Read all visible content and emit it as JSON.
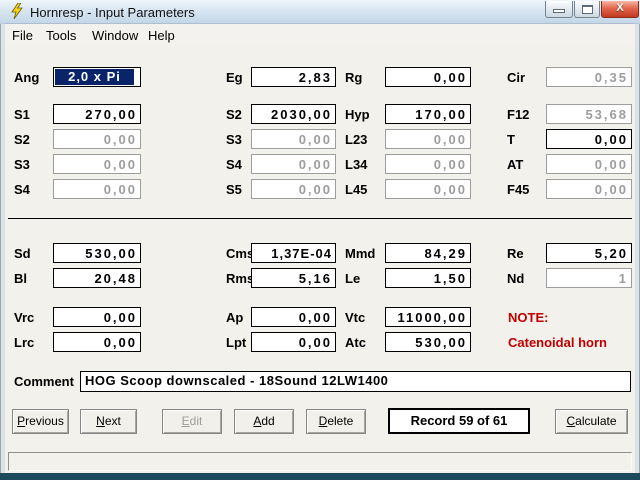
{
  "window": {
    "title": "Hornresp - Input Parameters",
    "icons": {
      "app_icon": "hornresp-lightning-bolt",
      "minimize_icon": "window-minimize",
      "maximize_icon": "window-maximize",
      "close_icon": "window-close"
    },
    "close_glyph": "X"
  },
  "menu": {
    "items": [
      "File",
      "Tools",
      "Window",
      "Help"
    ]
  },
  "fields": {
    "ang": {
      "label": "Ang",
      "value": "2,0 x Pi",
      "state": "selected"
    },
    "eg": {
      "label": "Eg",
      "value": "2,83"
    },
    "rg": {
      "label": "Rg",
      "value": "0,00"
    },
    "cir": {
      "label": "Cir",
      "value": "0,35",
      "state": "disabled"
    },
    "s1": {
      "label": "S1",
      "value": "270,00"
    },
    "s2a": {
      "label": "S2",
      "value": "2030,00"
    },
    "hyp": {
      "label": "Hyp",
      "value": "170,00"
    },
    "f12": {
      "label": "F12",
      "value": "53,68",
      "state": "disabled"
    },
    "s2b": {
      "label": "S2",
      "value": "0,00",
      "state": "disabled"
    },
    "s3a": {
      "label": "S3",
      "value": "0,00",
      "state": "disabled"
    },
    "l23": {
      "label": "L23",
      "value": "0,00",
      "state": "disabled"
    },
    "t": {
      "label": "T",
      "value": "0,00"
    },
    "s3b": {
      "label": "S3",
      "value": "0,00",
      "state": "disabled"
    },
    "s4a": {
      "label": "S4",
      "value": "0,00",
      "state": "disabled"
    },
    "l34": {
      "label": "L34",
      "value": "0,00",
      "state": "disabled"
    },
    "at": {
      "label": "AT",
      "value": "0,00",
      "state": "disabled"
    },
    "s4b": {
      "label": "S4",
      "value": "0,00",
      "state": "disabled"
    },
    "s5": {
      "label": "S5",
      "value": "0,00",
      "state": "disabled"
    },
    "l45": {
      "label": "L45",
      "value": "0,00",
      "state": "disabled"
    },
    "f45": {
      "label": "F45",
      "value": "0,00",
      "state": "disabled"
    },
    "sd": {
      "label": "Sd",
      "value": "530,00"
    },
    "cms": {
      "label": "Cms",
      "value": "1,37E-04"
    },
    "mmd": {
      "label": "Mmd",
      "value": "84,29"
    },
    "re": {
      "label": "Re",
      "value": "5,20"
    },
    "bl": {
      "label": "Bl",
      "value": "20,48"
    },
    "rms": {
      "label": "Rms",
      "value": "5,16"
    },
    "le": {
      "label": "Le",
      "value": "1,50"
    },
    "nd": {
      "label": "Nd",
      "value": "1",
      "state": "disabled"
    },
    "vrc": {
      "label": "Vrc",
      "value": "0,00"
    },
    "ap": {
      "label": "Ap",
      "value": "0,00"
    },
    "vtc": {
      "label": "Vtc",
      "value": "11000,00"
    },
    "lrc": {
      "label": "Lrc",
      "value": "0,00"
    },
    "lpt": {
      "label": "Lpt",
      "value": "0,00"
    },
    "atc": {
      "label": "Atc",
      "value": "530,00"
    }
  },
  "note": {
    "heading": "NOTE:",
    "text": "Catenoidal horn",
    "color": "#c00000"
  },
  "comment": {
    "label": "Comment",
    "value": "HOG Scoop downscaled - 18Sound 12LW1400"
  },
  "buttons": {
    "previous": "Previous",
    "next": "Next",
    "edit": "Edit",
    "add": "Add",
    "delete": "Delete",
    "calculate": "Calculate"
  },
  "record": {
    "text": "Record 59 of 61"
  },
  "status_bar": {
    "text": ""
  },
  "colors": {
    "selection_bg": "#0a246a",
    "note_red": "#c00000",
    "titlebar_top": "#eff6fc",
    "titlebar_bottom": "#c3d6e8",
    "close_button": "#c03b22",
    "disabled_gray": "#9d9d9d",
    "client_bg": "#f2f1ec",
    "frame_bottom": "#1d4a5c"
  }
}
